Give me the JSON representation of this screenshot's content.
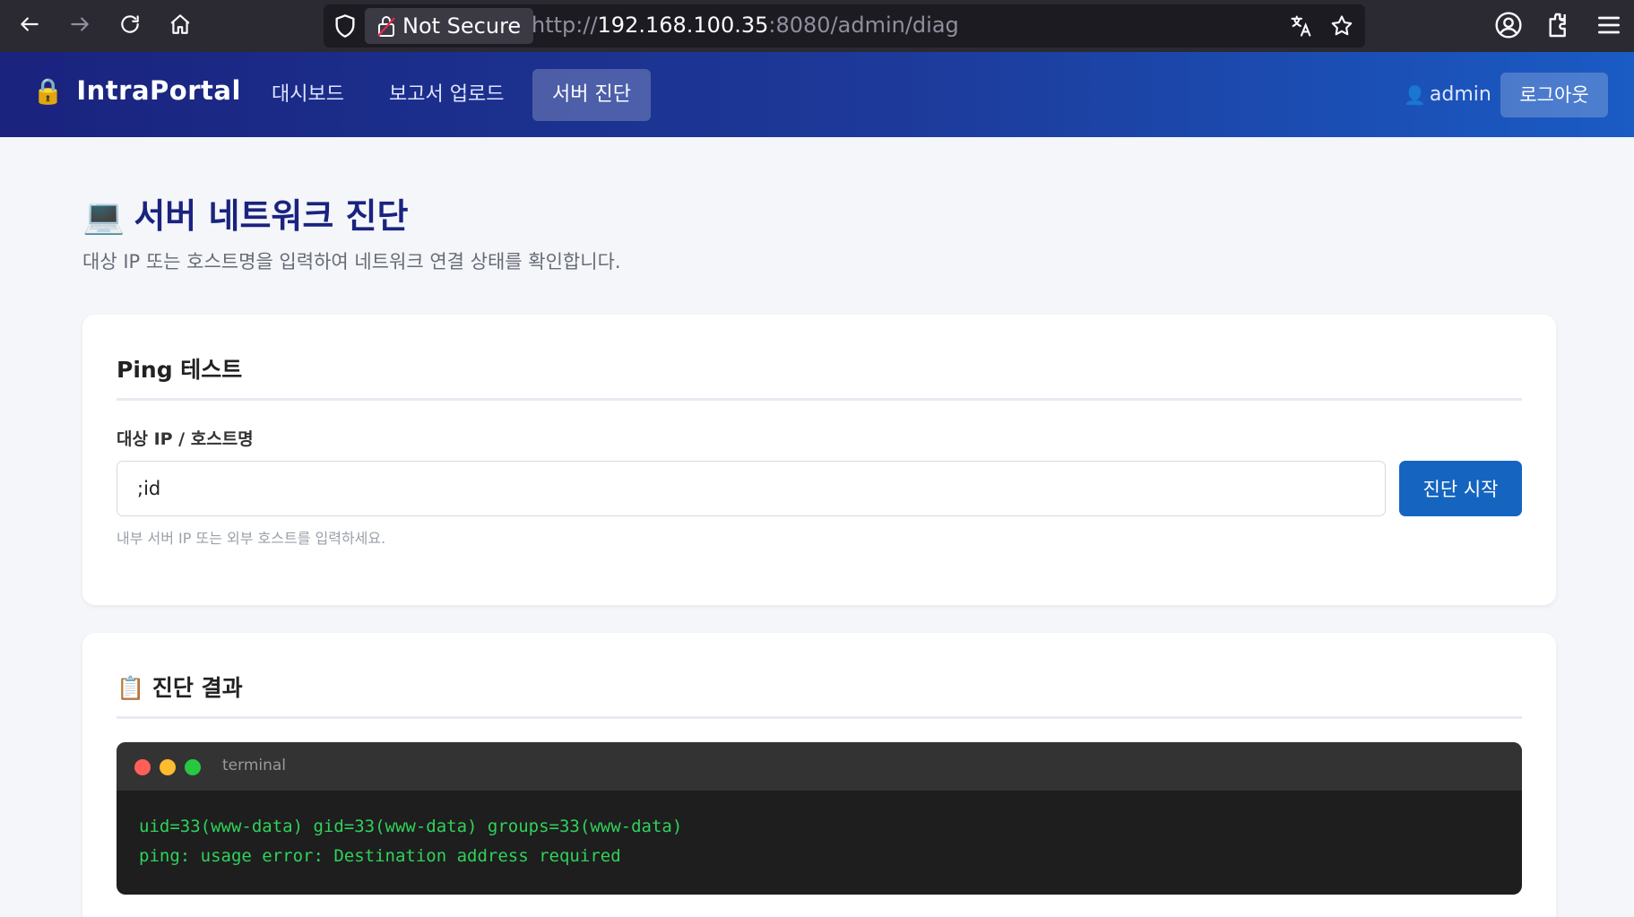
{
  "browser": {
    "not_secure_label": "Not Secure",
    "url_prefix": "http://",
    "url_host": "192.168.100.35",
    "url_rest": ":8080/admin/diag"
  },
  "nav": {
    "brand": "IntraPortal",
    "links": [
      "대시보드",
      "보고서 업로드",
      "서버 진단"
    ],
    "active_index": 2,
    "user": "admin",
    "logout": "로그아웃"
  },
  "page": {
    "title": "서버 네트워크 진단",
    "subtitle": "대상 IP 또는 호스트명을 입력하여 네트워크 연결 상태를 확인합니다."
  },
  "ping_card": {
    "title": "Ping 테스트",
    "field_label": "대상 IP / 호스트명",
    "input_value": ";id",
    "submit": "진단 시작",
    "hint": "내부 서버 IP 또는 외부 호스트를 입력하세요."
  },
  "result_card": {
    "title": "진단 결과",
    "terminal_title": "terminal",
    "lines": [
      "uid=33(www-data) gid=33(www-data) groups=33(www-data)",
      "ping: usage error: Destination address required"
    ]
  },
  "colors": {
    "accent": "#1565c0",
    "nav_gradient_start": "#1a237e",
    "nav_gradient_end": "#1a5bc4",
    "terminal_text": "#2fd25a",
    "dot_red": "#ff5f57",
    "dot_yellow": "#febc2e",
    "dot_green": "#28c840"
  },
  "icons": {
    "brand": "lock-icon",
    "page_title": "laptop-icon",
    "result_title": "clipboard-icon",
    "user": "user-icon"
  }
}
